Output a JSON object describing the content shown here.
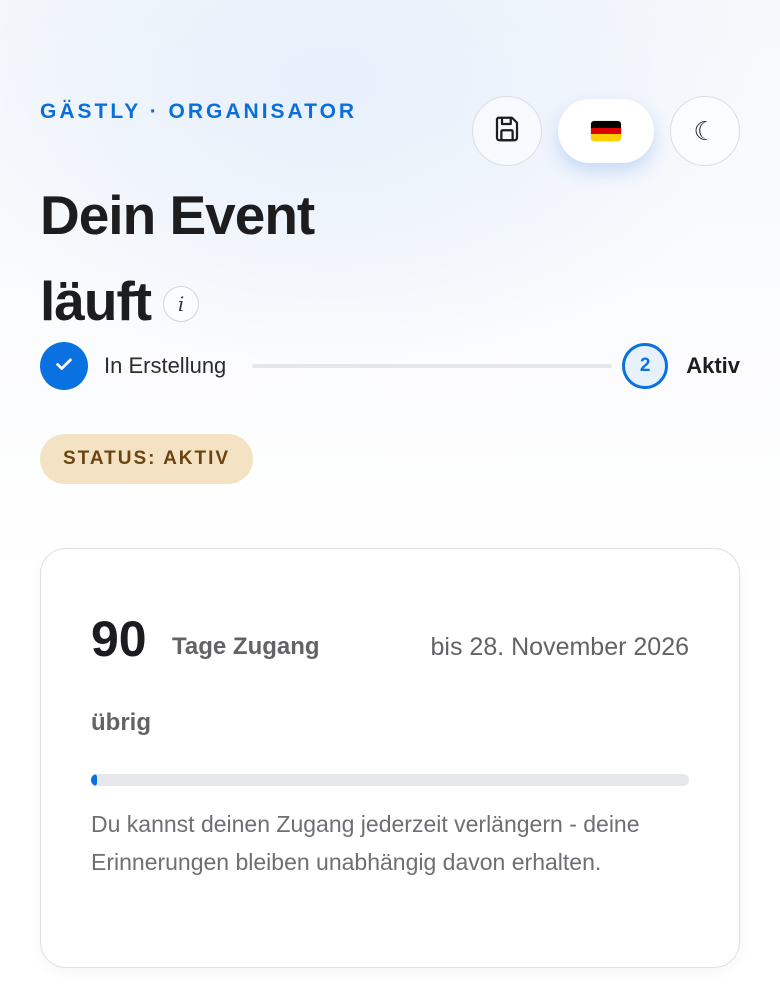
{
  "header": {
    "brand": "GÄSTLY · ORGANISATOR",
    "save_icon": "save-icon",
    "language_icon": "germany-flag-icon",
    "theme_icon": "moon-icon",
    "theme_glyph": "☾"
  },
  "hero": {
    "title_line1": "Dein Event",
    "title_line2": "läuft",
    "info_glyph": "i"
  },
  "stepper": {
    "steps": [
      {
        "label": "In Erstellung",
        "state": "done"
      },
      {
        "number": "2",
        "label": "Aktiv",
        "state": "current"
      }
    ]
  },
  "status": {
    "label": "STATUS: AKTIV"
  },
  "access_card": {
    "days": "90",
    "days_label": "Tage Zugang",
    "days_suffix": "übrig",
    "until": "bis 28. November 2026",
    "progress_percent": 1,
    "hint": "Du kannst deinen Zugang jederzeit verlängern - deine Erinnerungen bleiben unabhängig davon erhalten."
  },
  "colors": {
    "accent": "#0a72e0",
    "brand": "#0a6fd8",
    "badge_bg": "#f3e3c4",
    "badge_text": "#6b4410"
  }
}
